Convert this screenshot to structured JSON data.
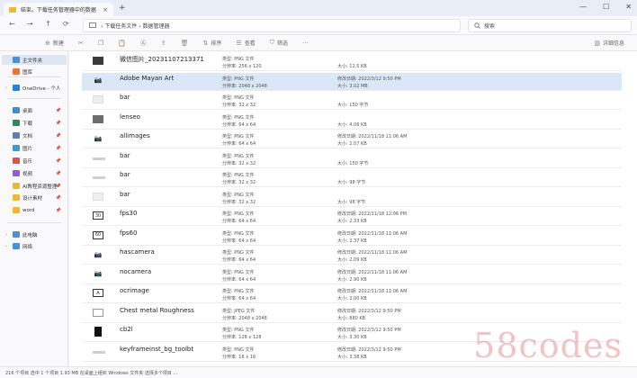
{
  "window": {
    "tab_title": "结束。下载任务管理器中的数据",
    "minimize": "—",
    "maximize": "☐",
    "close": "✕",
    "tab_close": "×",
    "new_tab": "+"
  },
  "nav": {
    "back": "←",
    "forward": "→",
    "up": "↑",
    "refresh": "⟳"
  },
  "address": {
    "path": "› 下载任务文件 › 数据管理器"
  },
  "search": {
    "placeholder": "搜索"
  },
  "toolbar": {
    "new_label": "新建",
    "sort_label": "排序",
    "view_label": "查看",
    "filter_label": "筛选",
    "details_label": "详细信息"
  },
  "sidebar": {
    "items": [
      {
        "label": "主文件夹",
        "color": "#4a90d9",
        "icon": "home-icon"
      },
      {
        "label": "图库",
        "color": "#e07a3c",
        "icon": "gallery-icon"
      },
      {
        "label": "OneDrive - 个人",
        "color": "#2f7fd6",
        "icon": "cloud-icon"
      },
      {
        "label": "桌面",
        "color": "#3b8fd9",
        "icon": "desktop-icon"
      },
      {
        "label": "下载",
        "color": "#2e8b57",
        "icon": "download-icon"
      },
      {
        "label": "文档",
        "color": "#5a7fb8",
        "icon": "document-icon"
      },
      {
        "label": "图片",
        "color": "#3a9ad9",
        "icon": "picture-icon"
      },
      {
        "label": "音乐",
        "color": "#d9534f",
        "icon": "music-icon"
      },
      {
        "label": "视频",
        "color": "#8e5ed6",
        "icon": "video-icon"
      },
      {
        "label": "AI教程资源整理",
        "color": "#e8b93a",
        "icon": "folder-icon"
      },
      {
        "label": "设计素材",
        "color": "#e8b93a",
        "icon": "folder-icon"
      },
      {
        "label": "word",
        "color": "#e8b93a",
        "icon": "folder-icon"
      },
      {
        "label": "此电脑",
        "color": "#4a90d9",
        "icon": "computer-icon"
      },
      {
        "label": "网络",
        "color": "#4a90d9",
        "icon": "network-icon"
      }
    ]
  },
  "files": [
    {
      "name": "微信图片_20231107213371",
      "type": "类型: PNG 文件",
      "dims": "分辨率: 256 x 120",
      "date": "",
      "size": "大小: 12.5 KB",
      "thumb": "dark"
    },
    {
      "name": "Adobe Mayan Art",
      "type": "类型: PNG 文件",
      "dims": "分辨率: 2048 x 2048",
      "date": "修改日期: 2022/3/12 9:50 PM",
      "size": "大小: 3.02 MB",
      "thumb": "cam"
    },
    {
      "name": "bar",
      "type": "类型: PNG 文件",
      "dims": "分辨率: 32 x 32",
      "date": "",
      "size": "大小: 150 字节",
      "thumb": "light"
    },
    {
      "name": "lenseo",
      "type": "类型: PNG 文件",
      "dims": "分辨率: 64 x 64",
      "date": "",
      "size": "大小: 4.06 KB",
      "thumb": "mid"
    },
    {
      "name": "allimages",
      "type": "类型: PNG 文件",
      "dims": "分辨率: 64 x 64",
      "date": "修改日期: 2022/11/18 11:06 AM",
      "size": "大小: 2.07 KB",
      "thumb": "cam"
    },
    {
      "name": "bar",
      "type": "类型: PNG 文件",
      "dims": "分辨率: 32 x 32",
      "date": "",
      "size": "大小: 150 字节",
      "thumb": "strip"
    },
    {
      "name": "bar",
      "type": "类型: PNG 文件",
      "dims": "分辨率: 32 x 32",
      "date": "",
      "size": "大小: 98 字节",
      "thumb": "strip"
    },
    {
      "name": "bar",
      "type": "类型: PNG 文件",
      "dims": "分辨率: 32 x 32",
      "date": "",
      "size": "大小: 98 字节",
      "thumb": "light"
    },
    {
      "name": "fps30",
      "type": "类型: PNG 文件",
      "dims": "分辨率: 64 x 64",
      "date": "修改日期: 2022/11/18 12:06 PM",
      "size": "大小: 2.33 KB",
      "thumb": "box",
      "glyph": "30"
    },
    {
      "name": "fps60",
      "type": "类型: PNG 文件",
      "dims": "分辨率: 64 x 64",
      "date": "修改日期: 2022/11/18 11:06 AM",
      "size": "大小: 2.37 KB",
      "thumb": "box",
      "glyph": "60"
    },
    {
      "name": "hascamera",
      "type": "类型: PNG 文件",
      "dims": "分辨率: 64 x 64",
      "date": "修改日期: 2022/11/18 11:06 AM",
      "size": "大小: 2.09 KB",
      "thumb": "cam"
    },
    {
      "name": "nocamera",
      "type": "类型: PNG 文件",
      "dims": "分辨率: 64 x 64",
      "date": "修改日期: 2022/11/18 11:06 AM",
      "size": "大小: 2.90 KB",
      "thumb": "cam"
    },
    {
      "name": "ocrimage",
      "type": "类型: PNG 文件",
      "dims": "分辨率: 64 x 64",
      "date": "修改日期: 2022/11/18 11:06 AM",
      "size": "大小: 2.00 KB",
      "thumb": "box",
      "glyph": "A"
    },
    {
      "name": "Chest metal Roughness",
      "type": "类型: JPEG 文件",
      "dims": "分辨率: 2048 x 2048",
      "date": "修改日期: 2022/3/12 9:50 PM",
      "size": "大小: 880 KB",
      "thumb": "sheet"
    },
    {
      "name": "cb2l",
      "type": "类型: PNG 文件",
      "dims": "分辨率: 128 x 128",
      "date": "修改日期: 2022/3/12 9:50 PM",
      "size": "大小: 3.30 KB",
      "thumb": "blk"
    },
    {
      "name": "keyframeinst_bg_toolbt",
      "type": "类型: PNG 文件",
      "dims": "分辨率: 16 x 16",
      "date": "修改日期: 2022/3/12 9:50 PM",
      "size": "大小: 3.38 KB",
      "thumb": "strip"
    }
  ],
  "status": {
    "text": "216 个项目   选中 1 个项目 1.93 MB   在桌面上组织 Windows 文件夹   选择多个项目 ..."
  },
  "watermark": {
    "text": "58codes"
  }
}
